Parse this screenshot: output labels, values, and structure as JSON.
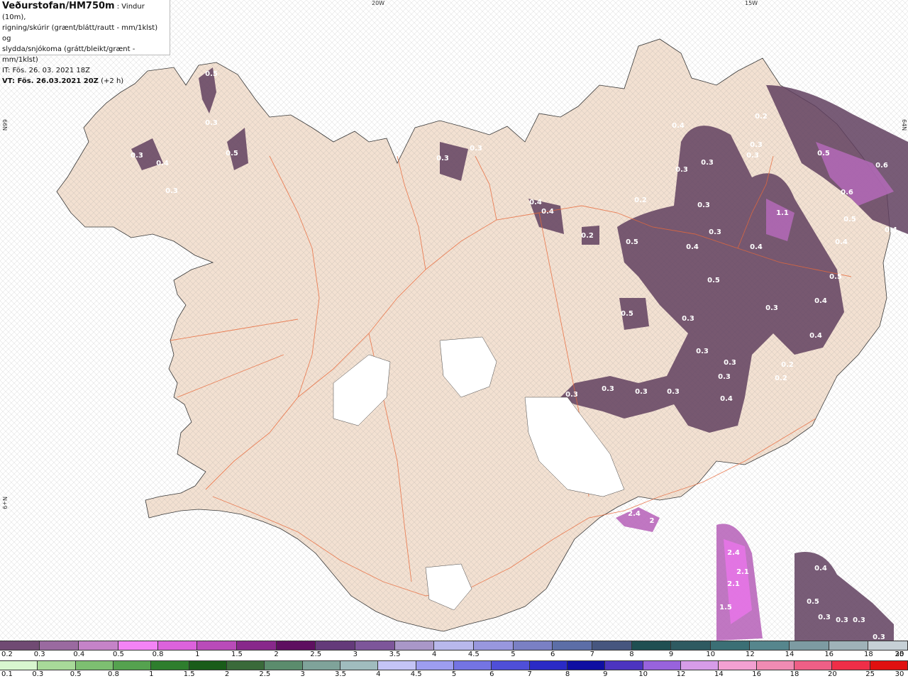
{
  "header": {
    "title": "Veðurstofan/HM750m",
    "title_suffix": " : Vindur (10m),",
    "line2": "rigning/skúrir (grænt/blátt/rautt - mm/1klst) og",
    "line3": "slydda/snjókoma (grátt/bleikt/grænt - mm/1klst)",
    "it": "IT: Fös. 26. 03. 2021 18Z",
    "vt": "VT: Fös. 26.03.2021 20Z",
    "vt_offset": " (+2 h)"
  },
  "grid_labels": {
    "lon_20w": "20W",
    "lon_15w": "15W",
    "lat_left_top": "66N",
    "lat_left_bottom": "N+9",
    "lat_right_top": "64N"
  },
  "map_labels": [
    {
      "text": "0.5",
      "lon": 298,
      "lat": 103
    },
    {
      "text": "0.3",
      "lon": 298,
      "lat": 172
    },
    {
      "text": "0.3",
      "lon": 193,
      "lat": 218
    },
    {
      "text": "0.4",
      "lon": 229,
      "lat": 229
    },
    {
      "text": "0.3",
      "lon": 242,
      "lat": 268
    },
    {
      "text": "0.5",
      "lon": 327,
      "lat": 215
    },
    {
      "text": "0.3",
      "lon": 624,
      "lat": 222
    },
    {
      "text": "0.3",
      "lon": 671,
      "lat": 208
    },
    {
      "text": "0.4",
      "lon": 956,
      "lat": 176
    },
    {
      "text": "0.2",
      "lon": 1073,
      "lat": 163
    },
    {
      "text": "0.3",
      "lon": 1066,
      "lat": 203
    },
    {
      "text": "0.3",
      "lon": 1061,
      "lat": 218
    },
    {
      "text": "0.3",
      "lon": 997,
      "lat": 228
    },
    {
      "text": "0.3",
      "lon": 961,
      "lat": 238
    },
    {
      "text": "0.5",
      "lon": 1161,
      "lat": 215
    },
    {
      "text": "0.6",
      "lon": 1243,
      "lat": 232
    },
    {
      "text": "0.6",
      "lon": 1194,
      "lat": 270
    },
    {
      "text": "0.2",
      "lon": 903,
      "lat": 281
    },
    {
      "text": "0.3",
      "lon": 992,
      "lat": 288
    },
    {
      "text": "0.4",
      "lon": 755,
      "lat": 284
    },
    {
      "text": "0.4",
      "lon": 772,
      "lat": 297
    },
    {
      "text": "1.1",
      "lon": 1103,
      "lat": 299
    },
    {
      "text": "0.5",
      "lon": 1198,
      "lat": 308
    },
    {
      "text": "0.4",
      "lon": 1256,
      "lat": 323
    },
    {
      "text": "0.2",
      "lon": 828,
      "lat": 331
    },
    {
      "text": "0.3",
      "lon": 1008,
      "lat": 326
    },
    {
      "text": "0.5",
      "lon": 891,
      "lat": 340
    },
    {
      "text": "0.4",
      "lon": 976,
      "lat": 347
    },
    {
      "text": "0.4",
      "lon": 1066,
      "lat": 347
    },
    {
      "text": "0.4",
      "lon": 1186,
      "lat": 340
    },
    {
      "text": "0.5",
      "lon": 1006,
      "lat": 394
    },
    {
      "text": "0.5",
      "lon": 1178,
      "lat": 389
    },
    {
      "text": "0.4",
      "lon": 1157,
      "lat": 423
    },
    {
      "text": "0.3",
      "lon": 1088,
      "lat": 433
    },
    {
      "text": "0.5",
      "lon": 884,
      "lat": 441
    },
    {
      "text": "0.3",
      "lon": 970,
      "lat": 448
    },
    {
      "text": "0.4",
      "lon": 1150,
      "lat": 472
    },
    {
      "text": "0.3",
      "lon": 990,
      "lat": 494
    },
    {
      "text": "0.3",
      "lon": 1029,
      "lat": 510
    },
    {
      "text": "0.3",
      "lon": 643,
      "lat": 507
    },
    {
      "text": "0.2",
      "lon": 1110,
      "lat": 513
    },
    {
      "text": "0.3",
      "lon": 1021,
      "lat": 530
    },
    {
      "text": "0.2",
      "lon": 1101,
      "lat": 532
    },
    {
      "text": "0.3",
      "lon": 857,
      "lat": 547
    },
    {
      "text": "0.3",
      "lon": 904,
      "lat": 551
    },
    {
      "text": "0.3",
      "lon": 949,
      "lat": 551
    },
    {
      "text": "0.3",
      "lon": 806,
      "lat": 555
    },
    {
      "text": "0.4",
      "lon": 1024,
      "lat": 561
    },
    {
      "text": "2.4",
      "lon": 894,
      "lat": 723
    },
    {
      "text": "2",
      "lon": 919,
      "lat": 733
    },
    {
      "text": "2.4",
      "lon": 1034,
      "lat": 778
    },
    {
      "text": "2.1",
      "lon": 1047,
      "lat": 805
    },
    {
      "text": "2.1",
      "lon": 1034,
      "lat": 822
    },
    {
      "text": "0.4",
      "lon": 1157,
      "lat": 800
    },
    {
      "text": "1.5",
      "lon": 1023,
      "lat": 855
    },
    {
      "text": "0.5",
      "lon": 1146,
      "lat": 847
    },
    {
      "text": "0.3",
      "lon": 1162,
      "lat": 869
    },
    {
      "text": "0.3",
      "lon": 1187,
      "lat": 873
    },
    {
      "text": "0.3",
      "lon": 1211,
      "lat": 873
    },
    {
      "text": "0.3",
      "lon": 1239,
      "lat": 897
    }
  ],
  "legend_snow": {
    "colors": [
      "#704a73",
      "#9a6aa0",
      "#c583c8",
      "#f383f5",
      "#dc62dc",
      "#b94bb9",
      "#88288b",
      "#5e0f60",
      "#643a7a",
      "#7d569a",
      "#a997c8",
      "#b8b8ec",
      "#9897de",
      "#7a80c4",
      "#5c6ea7",
      "#46567f",
      "#1f4f52",
      "#2e5a61",
      "#3b6f75",
      "#56868d",
      "#7d9ba2",
      "#9fb2b8",
      "#c6d0d6"
    ],
    "labels": [
      "0.2",
      "0.3",
      "0.4",
      "0.5",
      "0.8",
      "1",
      "1.5",
      "2",
      "2.5",
      "3",
      "3.5",
      "4",
      "4.5",
      "5",
      "6",
      "7",
      "8",
      "9",
      "10",
      "12",
      "14",
      "16",
      "18",
      "20",
      "25",
      "30"
    ]
  },
  "legend_rain": {
    "colors": [
      "#d8f5cf",
      "#a8d999",
      "#7dbf71",
      "#55a24f",
      "#2e7e2d",
      "#195c19",
      "#3a6a3a",
      "#5b8c6d",
      "#7fa39a",
      "#a0bcbe",
      "#c4c4f5",
      "#9d9df0",
      "#7474e3",
      "#4f4fd8",
      "#2a2ac6",
      "#0f0fa2",
      "#4c34c0",
      "#9863dd",
      "#d79ce8",
      "#f2a0d2",
      "#f08bb3",
      "#ee5f86",
      "#ef2e48",
      "#e01010"
    ],
    "labels": [
      "0.1",
      "0.3",
      "0.5",
      "0.8",
      "1",
      "1.5",
      "2",
      "2.5",
      "3",
      "3.5",
      "4",
      "4.5",
      "5",
      "6",
      "7",
      "8",
      "9",
      "10",
      "12",
      "14",
      "16",
      "18",
      "20",
      "25",
      "30"
    ]
  }
}
